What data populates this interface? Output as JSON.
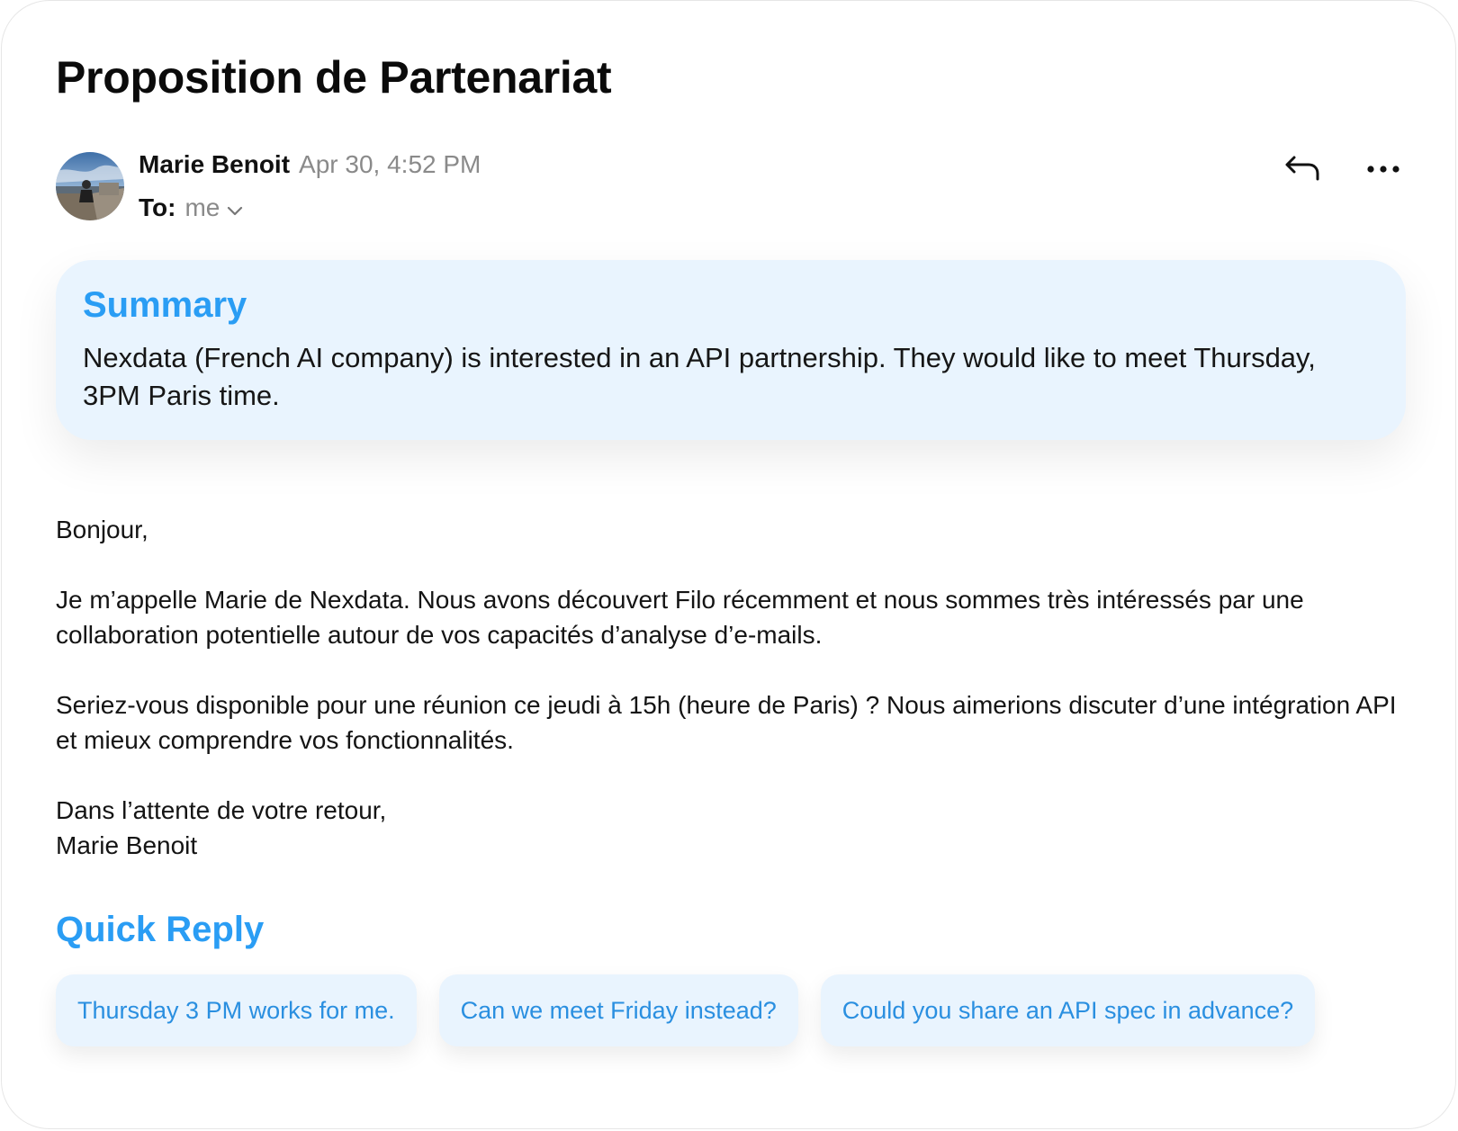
{
  "email": {
    "subject": "Proposition de Partenariat",
    "sender_name": "Marie Benoit",
    "date": "Apr 30, 4:52 PM",
    "to_label": "To:",
    "to_value": "me"
  },
  "summary": {
    "title": "Summary",
    "text": "Nexdata (French AI company) is interested in an API partnership. They would like to meet Thursday, 3PM Paris time."
  },
  "body": {
    "greeting": "Bonjour,",
    "paragraph1": "Je m’appelle Marie de Nexdata. Nous avons découvert Filo récemment et nous sommes très intéressés par une collaboration potentielle autour de vos capacités d’analyse d’e-mails.",
    "paragraph2": "Seriez-vous disponible pour une réunion ce jeudi à 15h (heure de Paris) ? Nous aimerions discuter d’une intégration API et mieux comprendre vos fonctionnalités.",
    "closing": "Dans l’attente de votre retour,",
    "signature": "Marie Benoit"
  },
  "quick_reply": {
    "title": "Quick Reply",
    "options": [
      "Thursday 3 PM works for me.",
      "Can we meet Friday instead?",
      "Could you share an API spec in advance?"
    ]
  },
  "icons": {
    "reply": "reply-icon",
    "more": "more-horizontal-icon",
    "chevron": "chevron-down-icon"
  },
  "colors": {
    "accent": "#2a9df4",
    "summary_bg": "#e9f4fe",
    "muted_text": "#8a8a8a"
  }
}
